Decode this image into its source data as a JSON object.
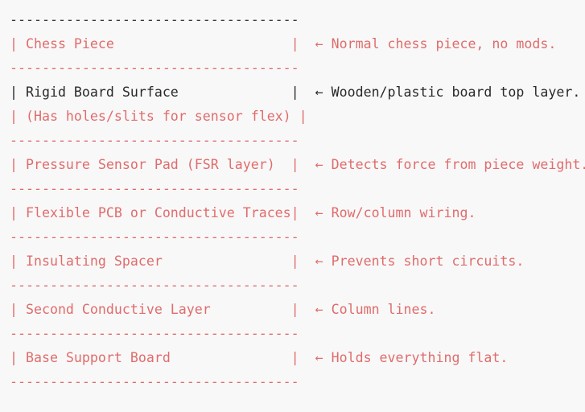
{
  "diagram": {
    "lines": [
      {
        "text": "------------------------------------",
        "color": "#3a3a3a"
      },
      {
        "text": "| Chess Piece                      |  ← Normal chess piece, no mods.",
        "color": "#e06c6c"
      },
      {
        "text": "------------------------------------",
        "color": "#e06c6c"
      },
      {
        "text": "| Rigid Board Surface              |  ← Wooden/plastic board top layer.",
        "color": "#2a2a2a"
      },
      {
        "text": "| (Has holes/slits for sensor flex) |",
        "color": "#e06c6c"
      },
      {
        "text": "------------------------------------",
        "color": "#e06c6c"
      },
      {
        "text": "| Pressure Sensor Pad (FSR layer)  |  ← Detects force from piece weight.",
        "color": "#e06c6c"
      },
      {
        "text": "------------------------------------",
        "color": "#e06c6c"
      },
      {
        "text": "| Flexible PCB or Conductive Traces|  ← Row/column wiring.",
        "color": "#e06c6c"
      },
      {
        "text": "------------------------------------",
        "color": "#e06c6c"
      },
      {
        "text": "| Insulating Spacer                |  ← Prevents short circuits.",
        "color": "#e06c6c"
      },
      {
        "text": "------------------------------------",
        "color": "#e06c6c"
      },
      {
        "text": "| Second Conductive Layer          |  ← Column lines.",
        "color": "#e06c6c"
      },
      {
        "text": "------------------------------------",
        "color": "#e06c6c"
      },
      {
        "text": "| Base Support Board               |  ← Holds everything flat.",
        "color": "#e06c6c"
      },
      {
        "text": "------------------------------------",
        "color": "#e06c6c"
      }
    ]
  }
}
